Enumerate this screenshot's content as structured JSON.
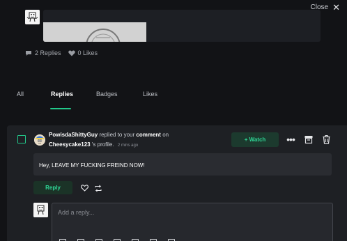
{
  "close": {
    "label": "Close",
    "icon": "close-icon"
  },
  "post": {
    "replies_count": "2 Replies",
    "likes_count": "0 Likes"
  },
  "tabs": [
    {
      "label": "All"
    },
    {
      "label": "Replies"
    },
    {
      "label": "Badges"
    },
    {
      "label": "Likes"
    }
  ],
  "notification": {
    "user": "PowisdaShittyGuy",
    "action": "replied to your",
    "object": "comment",
    "preposition": "on",
    "profile": "Cheesycake123",
    "profile_suffix": "'s profile.",
    "time": "2 mins ago",
    "message": "Hey, LEAVE MY FUCKING FREIND NOW!",
    "watch_label": "+ Watch",
    "reply_label": "Reply",
    "reply_placeholder": "Add a reply..."
  },
  "colors": {
    "accent": "#22c88a",
    "background": "#121316",
    "card": "#1e2024"
  }
}
